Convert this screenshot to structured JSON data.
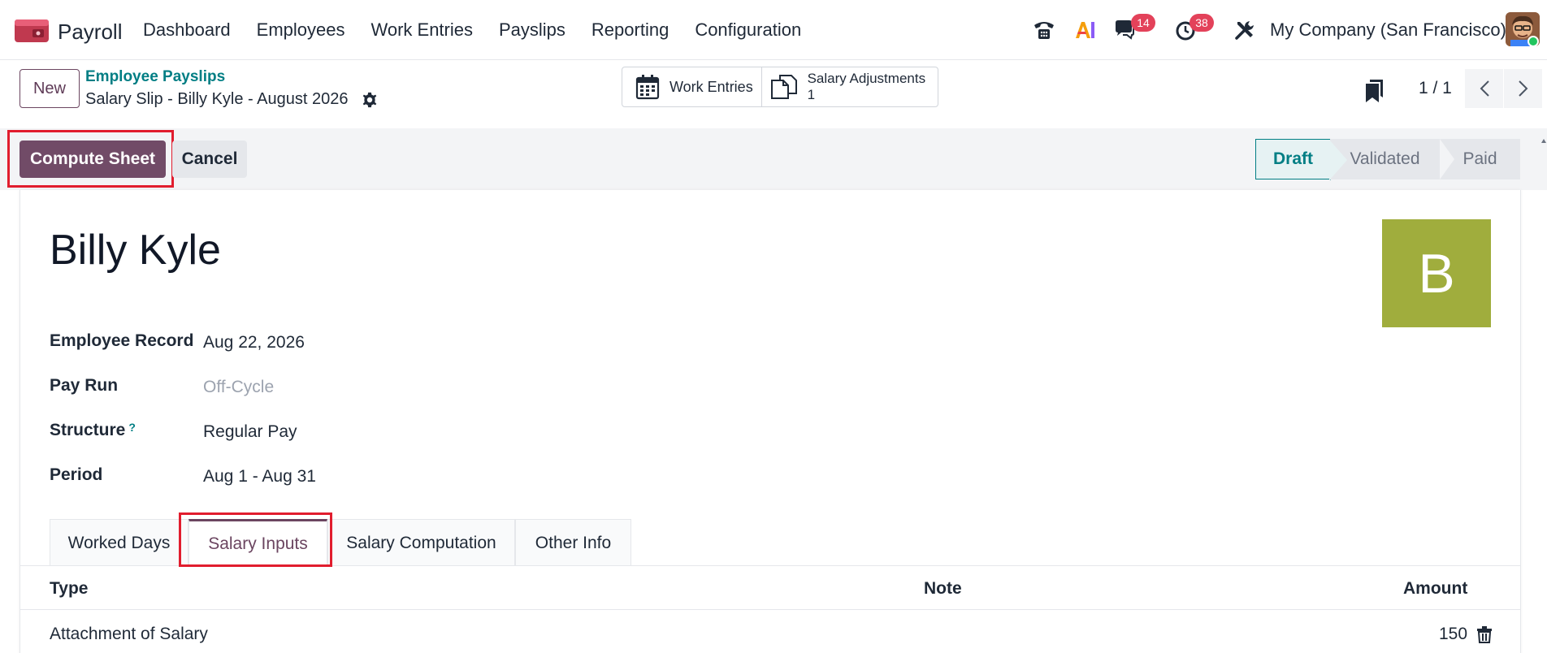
{
  "navbar": {
    "app_name": "Payroll",
    "menu": [
      "Dashboard",
      "Employees",
      "Work Entries",
      "Payslips",
      "Reporting",
      "Configuration"
    ],
    "messages_count": "14",
    "activities_count": "38",
    "company": "My Company (San Francisco)"
  },
  "control_panel": {
    "new_label": "New",
    "breadcrumb_parent": "Employee Payslips",
    "breadcrumb_current": "Salary Slip - Billy Kyle - August 2026",
    "smart_buttons": {
      "work_entries": "Work Entries",
      "salary_adjustments": "Salary Adjustments",
      "salary_adjustments_count": "1"
    },
    "pager": "1 / 1"
  },
  "statusbar": {
    "compute_label": "Compute Sheet",
    "cancel_label": "Cancel",
    "stages": [
      "Draft",
      "Validated",
      "Paid"
    ],
    "active_stage": "Draft"
  },
  "form": {
    "employee_name": "Billy Kyle",
    "avatar_initial": "B",
    "avatar_color": "#a0ad3d",
    "fields": [
      {
        "label": "Employee Record",
        "value": "Aug 22, 2026"
      },
      {
        "label": "Pay Run",
        "value": "Off-Cycle"
      },
      {
        "label": "Structure",
        "value": "Regular Pay",
        "help": "?"
      },
      {
        "label": "Period",
        "value": "Aug 1 - Aug 31"
      }
    ],
    "tabs": [
      "Worked Days",
      "Salary Inputs",
      "Salary Computation",
      "Other Info"
    ],
    "active_tab": "Salary Inputs",
    "table": {
      "columns": [
        "Type",
        "Note",
        "Amount"
      ],
      "rows": [
        {
          "type": "Attachment of Salary",
          "note": "",
          "amount": "150"
        }
      ]
    }
  },
  "colors": {
    "brand": "#714b67",
    "accent": "#017e84",
    "highlight": "#e11d2e"
  }
}
